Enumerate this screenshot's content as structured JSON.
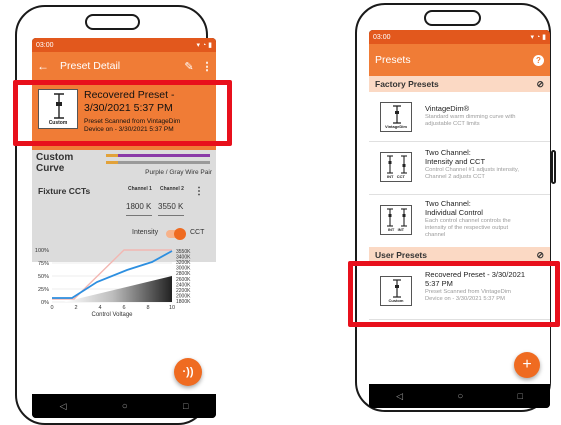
{
  "left_phone": {
    "status_time": "03:00",
    "app_title": "Preset Detail",
    "preset_card": {
      "thumbnail_label": "Custom",
      "title_line1": "Recovered Preset -",
      "title_line2": "3/30/2021 5:37 PM",
      "subtitle_line1": "Preset Scanned from VintageDim",
      "subtitle_line2": "Device on - 3/30/2021 5:37 PM"
    },
    "curve": {
      "label_line1": "Custom",
      "label_line2": "Curve",
      "wire_label": "Purple / Gray Wire Pair"
    },
    "fixture_ccts": {
      "label": "Fixture CCTs",
      "channel1_header": "Channel 1",
      "channel2_header": "Channel 2",
      "channel1_value": "1800 K",
      "channel2_value": "3550 K"
    },
    "toggle": {
      "left_label": "Intensity",
      "right_label": "CCT",
      "state": "CCT"
    },
    "graph": {
      "y_ticks": [
        "100%",
        "75%",
        "50%",
        "25%",
        "0%"
      ],
      "x_ticks": [
        "0",
        "2",
        "4",
        "6",
        "8",
        "10"
      ],
      "x_label": "Control Voltage",
      "cct_ticks": [
        "3550K",
        "3400K",
        "3200K",
        "3000K",
        "2800K",
        "2600K",
        "2400K",
        "2200K",
        "2000K",
        "1800K"
      ]
    }
  },
  "right_phone": {
    "status_time": "03:00",
    "app_title": "Presets",
    "factory_header": "Factory Presets",
    "factory_items": [
      {
        "thumb_label": "VintageDim",
        "title": "VintageDim®",
        "subtitle_lines": [
          "Standard warm dimming curve with",
          "adjustable CCT limits"
        ]
      },
      {
        "thumb_label": "INT   CCT",
        "title_lines": [
          "Two Channel:",
          "Intensity and CCT"
        ],
        "subtitle_lines": [
          "Control Channel #1 adjusts intensity,",
          "Channel 2 adjusts CCT"
        ]
      },
      {
        "thumb_label": "INT   INT",
        "title_lines": [
          "Two Channel:",
          "Individual Control"
        ],
        "subtitle_lines": [
          "Each control channel controls the",
          "intensity of the respective output",
          "channel"
        ]
      }
    ],
    "user_header": "User Presets",
    "user_items": [
      {
        "thumb_label": "Custom",
        "title_lines": [
          "Recovered Preset - 3/30/2021",
          "5:37 PM"
        ],
        "subtitle_lines": [
          "Preset Scanned from VintageDim",
          "Device on - 3/30/2021 5:37 PM"
        ]
      }
    ]
  },
  "colors": {
    "accent_orange": "#ef6b21",
    "appbar_orange": "#f07c36",
    "statusbar_orange": "#e2581d",
    "section_header_bg": "#fbd9c4",
    "highlight_red": "#e8101c",
    "graph_blue": "#2d8fe0",
    "graph_pink": "#f2b7b2"
  }
}
